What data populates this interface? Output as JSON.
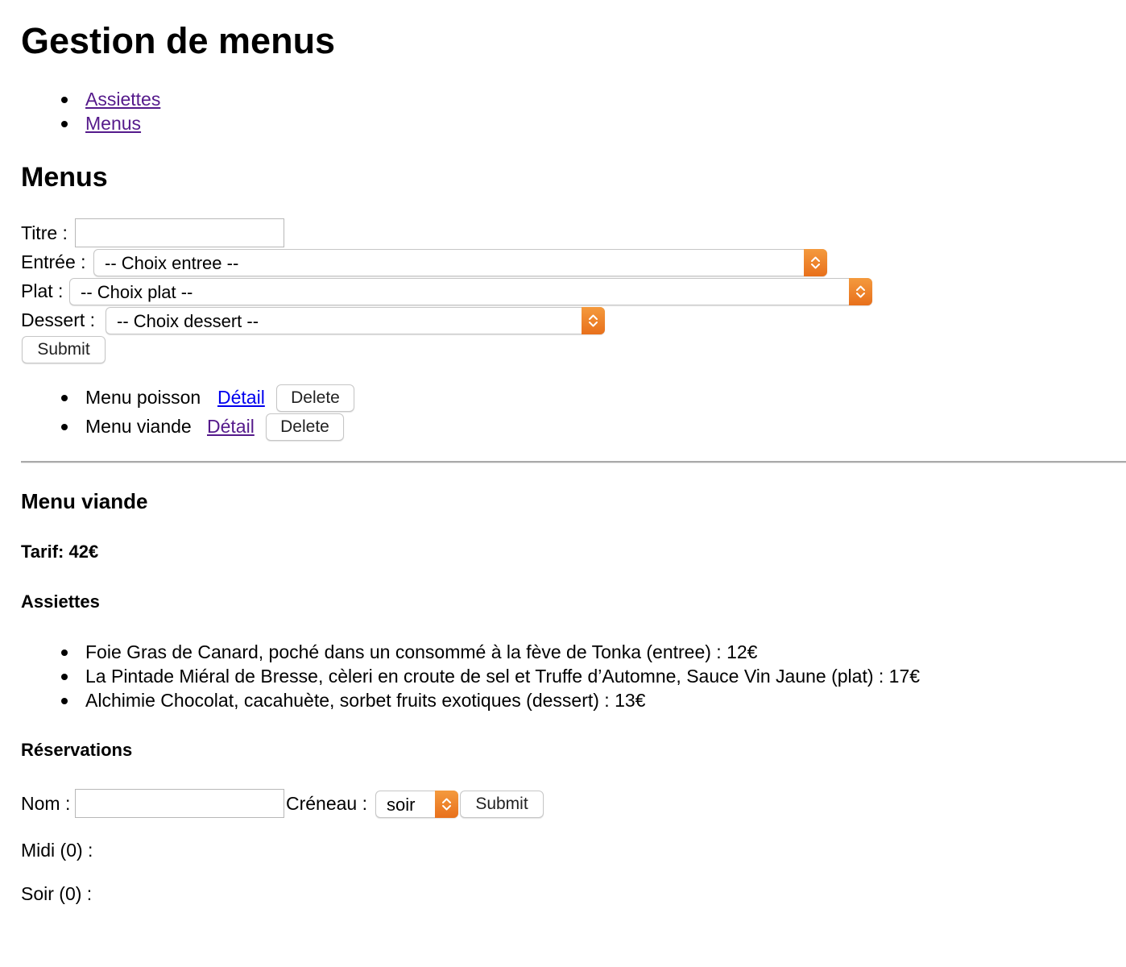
{
  "page": {
    "title": "Gestion de menus"
  },
  "nav": {
    "items": [
      {
        "label": "Assiettes"
      },
      {
        "label": "Menus"
      }
    ]
  },
  "menus_section": {
    "heading": "Menus",
    "form": {
      "titre_label": "Titre :",
      "titre_value": "",
      "entree_label": "Entrée :",
      "entree_selected": "-- Choix entree --",
      "plat_label": "Plat :",
      "plat_selected": "-- Choix plat --",
      "dessert_label": "Dessert :",
      "dessert_selected": "-- Choix dessert --",
      "submit_label": "Submit"
    },
    "list": [
      {
        "name": "Menu poisson",
        "detail_label": "Détail",
        "delete_label": "Delete"
      },
      {
        "name": "Menu viande",
        "detail_label": "Détail",
        "delete_label": "Delete"
      }
    ]
  },
  "detail": {
    "title": "Menu viande",
    "tarif": "Tarif: 42€",
    "assiettes_heading": "Assiettes",
    "assiettes": [
      "Foie Gras de Canard, poché dans un consommé à la fève de Tonka (entree) : 12€",
      "La Pintade Miéral de Bresse, cèleri en croute de sel et Truffe d’Automne, Sauce Vin Jaune (plat) : 17€",
      "Alchimie Chocolat, cacahuète, sorbet fruits exotiques (dessert) : 13€"
    ],
    "reservations_heading": "Réservations",
    "reservation_form": {
      "nom_label": "Nom :",
      "nom_value": "",
      "creneau_label": "Créneau :",
      "creneau_selected": "soir",
      "submit_label": "Submit"
    },
    "midi": "Midi (0) :",
    "soir": "Soir (0) :"
  },
  "colors": {
    "link_visited": "#551a8b",
    "link_unvisited": "#0000ee",
    "select_accent": "#ee7d24"
  }
}
